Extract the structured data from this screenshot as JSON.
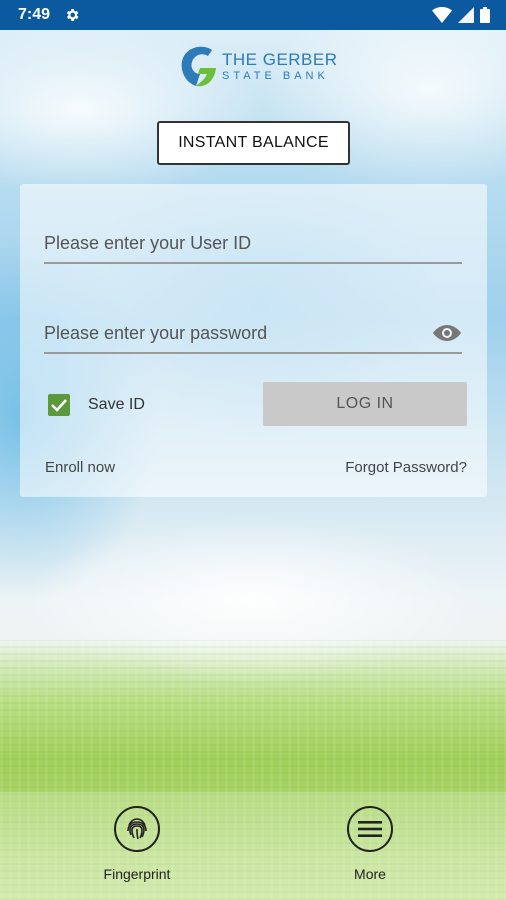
{
  "status_bar": {
    "time": "7:49",
    "icons": [
      "settings-gear-icon",
      "wifi-icon",
      "signal-icon",
      "battery-icon"
    ]
  },
  "brand": {
    "line1": "THE GERBER",
    "line2": "STATE BANK",
    "colors": {
      "blue": "#2d7bb8",
      "green": "#6cbf3c"
    }
  },
  "instant_balance": {
    "label": "INSTANT BALANCE"
  },
  "login": {
    "user_id_placeholder": "Please enter your User ID",
    "password_placeholder": "Please enter your password",
    "save_id_label": "Save ID",
    "save_id_checked": true,
    "login_button": "LOG IN",
    "enroll_link": "Enroll now",
    "forgot_link": "Forgot Password?"
  },
  "bottom_nav": {
    "fingerprint_label": "Fingerprint",
    "more_label": "More"
  },
  "theme": {
    "status_bar_bg": "#0b5aa0",
    "checkbox_green": "#5a9a3a",
    "button_disabled_bg": "#c9c9c9"
  }
}
